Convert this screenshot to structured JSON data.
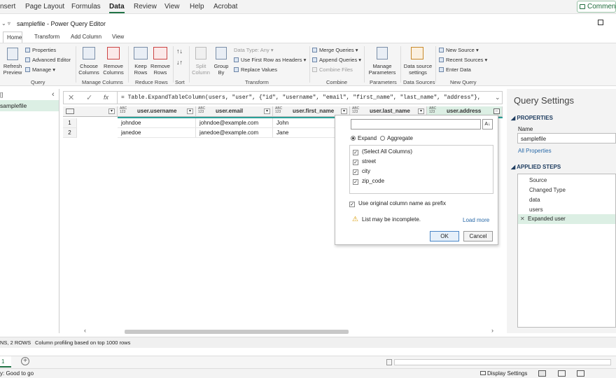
{
  "excel_tabs": [
    "nsert",
    "Page Layout",
    "Formulas",
    "Data",
    "Review",
    "View",
    "Help",
    "Acrobat"
  ],
  "comments_label": "Commen",
  "pq": {
    "title": "samplefile - Power Query Editor",
    "tabs": [
      "Home",
      "Transform",
      "Add Column",
      "View"
    ]
  },
  "ribbon": {
    "refresh": "Refresh\nPreview",
    "properties": "Properties",
    "advanced_editor": "Advanced Editor",
    "manage": "Manage",
    "query_group": "Query",
    "choose_columns": "Choose\nColumns",
    "remove_columns": "Remove\nColumns",
    "manage_columns_group": "Manage Columns",
    "keep_rows": "Keep\nRows",
    "remove_rows": "Remove\nRows",
    "reduce_rows_group": "Reduce Rows",
    "sort_group": "Sort",
    "split_column": "Split\nColumn",
    "group_by": "Group\nBy",
    "data_type": "Data Type: Any",
    "first_row_headers": "Use First Row as Headers",
    "replace_values": "Replace Values",
    "transform_group": "Transform",
    "merge_queries": "Merge Queries",
    "append_queries": "Append Queries",
    "combine_files": "Combine Files",
    "combine_group": "Combine",
    "manage_parameters": "Manage\nParameters",
    "parameters_group": "Parameters",
    "data_source_settings": "Data source\nsettings",
    "data_sources_group": "Data Sources",
    "new_source": "New Source",
    "recent_sources": "Recent Sources",
    "enter_data": "Enter Data",
    "new_query_group": "New Query"
  },
  "left_pane": {
    "header": "[]",
    "query": "samplefile"
  },
  "formula": "= Table.ExpandTableColumn(users, \"user\", {\"id\", \"username\", \"email\", \"first_name\", \"last_name\", \"address\"},",
  "grid": {
    "columns": [
      "user.username",
      "user.email",
      "user.first_name",
      "user.last_name",
      "user.address"
    ],
    "type_label": "ABC\n123",
    "rows": [
      {
        "num": "1",
        "username": "johndoe",
        "email": "johndoe@example.com",
        "first_name": "John"
      },
      {
        "num": "2",
        "username": "janedoe",
        "email": "janedoe@example.com",
        "first_name": "Jane"
      }
    ]
  },
  "panel": {
    "expand": "Expand",
    "aggregate": "Aggregate",
    "items": [
      "(Select All Columns)",
      "street",
      "city",
      "zip_code"
    ],
    "prefix": "Use original column name as prefix",
    "warning": "List may be incomplete.",
    "load_more": "Load more",
    "ok": "OK",
    "cancel": "Cancel"
  },
  "settings": {
    "title": "Query Settings",
    "properties": "PROPERTIES",
    "name_label": "Name",
    "name_value": "samplefile",
    "all_properties": "All Properties",
    "applied_steps": "APPLIED STEPS",
    "steps": [
      "Source",
      "Changed Type",
      "data",
      "users",
      "Expanded user"
    ]
  },
  "status": {
    "left": "NS, 2 ROWS",
    "profiling": "Column profiling based on top 1000 rows"
  },
  "excel_status": {
    "ready": "y: Good to go",
    "display": "Display Settings",
    "sheet": "1"
  },
  "colors": {
    "accent": "#217346",
    "highlight": "#dcefe4",
    "teal_bar": "#2aa198"
  }
}
